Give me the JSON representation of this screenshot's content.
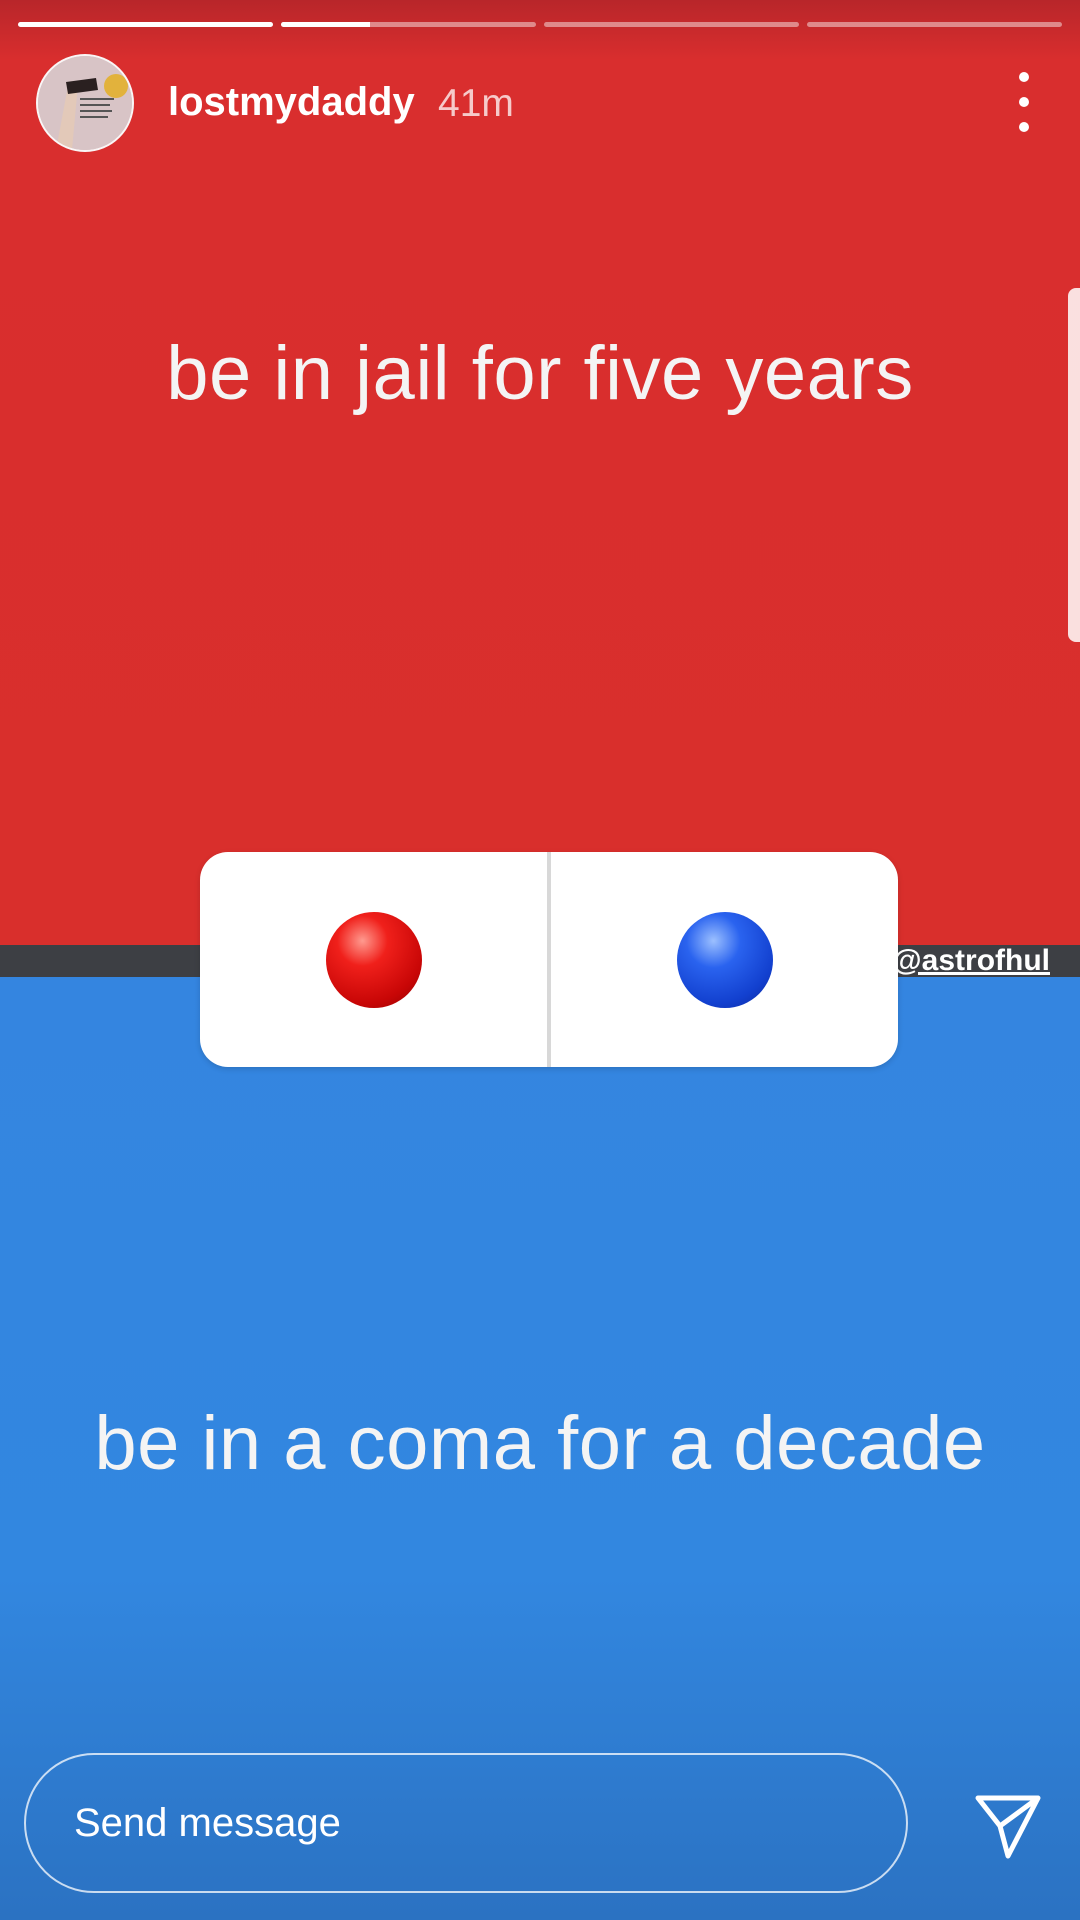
{
  "story": {
    "progress": [
      1.0,
      0.35,
      0,
      0
    ],
    "user": {
      "username": "lostmydaddy",
      "time_ago": "41m"
    },
    "colors": {
      "top": "#d92f2c",
      "bottom": "#3287e0",
      "divider": "#3d3f44"
    },
    "option_top": "be in jail for five years",
    "option_bottom": "be in a coma for a decade",
    "credit": "@astrofhul",
    "poll": {
      "options": [
        {
          "icon": "red-ball-icon"
        },
        {
          "icon": "blue-ball-icon"
        }
      ]
    },
    "footer": {
      "message_placeholder": "Send message",
      "send_icon": "paper-plane-icon"
    },
    "icons": {
      "more": "vertical-dots-icon"
    }
  }
}
